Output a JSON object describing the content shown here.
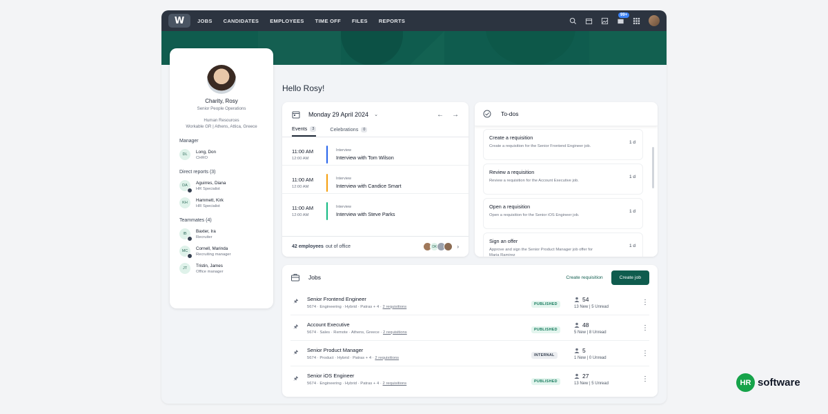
{
  "topbar": {
    "logo": "W",
    "nav": [
      "JOBS",
      "CANDIDATES",
      "EMPLOYEES",
      "TIME OFF",
      "FILES",
      "REPORTS"
    ],
    "notification_badge": "99+"
  },
  "greeting": "Hello Rosy!",
  "profile": {
    "name": "Charity, Rosy",
    "title": "Senior People Operations",
    "department": "Human Resources",
    "location": "Workable GR | Athens, Attica, Greece",
    "manager_title": "Manager",
    "manager": {
      "initials": "DL",
      "name": "Long, Don",
      "role": "CHRO"
    },
    "reports_title": "Direct reports  (3)",
    "reports": [
      {
        "initials": "DA",
        "name": "Aguirres, Diana",
        "role": "HR Specialist"
      },
      {
        "initials": "KH",
        "name": "Hammett, Kirk",
        "role": "HR Specialist"
      }
    ],
    "teammates_title": "Teammates (4)",
    "teammates": [
      {
        "initials": "IB",
        "name": "Baxter, Ira",
        "role": "Recruiter"
      },
      {
        "initials": "MC",
        "name": "Cornell, Marinda",
        "role": "Recruiting manager"
      },
      {
        "initials": "JT",
        "name": "Tristin, James",
        "role": "Office manager"
      }
    ]
  },
  "calendar": {
    "date": "Monday 29 April 2024",
    "tabs": [
      {
        "label": "Events",
        "count": "3"
      },
      {
        "label": "Celebrations",
        "count": "0"
      }
    ],
    "events": [
      {
        "start": "11:00 AM",
        "end": "12:00 AM",
        "type": "Interview",
        "title": "Interview with Tom Wilson",
        "color": "#2563eb"
      },
      {
        "start": "11:00 AM",
        "end": "12:00 AM",
        "type": "Interview",
        "title": "Interview with Candice Smart",
        "color": "#f59e0b"
      },
      {
        "start": "11:00 AM",
        "end": "12:00 AM",
        "type": "Interview",
        "title": "Interview with Steve Parks",
        "color": "#10b981"
      }
    ],
    "footer_count": "42 employees",
    "footer_text": "out of office",
    "footer_avatar_initials": "DK"
  },
  "todos": {
    "title": "To-dos",
    "items": [
      {
        "title": "Create a requisition",
        "desc": "Create a requisition for the Senior Frontend Engineer  job.",
        "age": "1 d"
      },
      {
        "title": "Review a requisition",
        "desc": "Review a requisition for the Account Executive job.",
        "age": "1 d"
      },
      {
        "title": "Open a requisition",
        "desc": "Open a requisition for the Senior iOS Engineer job.",
        "age": "1 d"
      },
      {
        "title": "Sign an offer",
        "desc": "Approve and sign the Senior Product Manager job offer for Maria Ramirez",
        "age": "1 d"
      }
    ]
  },
  "jobs": {
    "title": "Jobs",
    "create_requisition": "Create requisition",
    "create_job": "Create job",
    "rows": [
      {
        "name": "Senior Frontend Engineer",
        "meta": "5674 · Engineering · Hybrid · Patras + 4 · ",
        "req": "2 requisitions",
        "status": "PUBLISHED",
        "total": "54",
        "new": "13 New",
        "unread": "5 Unread"
      },
      {
        "name": "Account Executive",
        "meta": "5674 · Sales · Remote · Athens, Greece · ",
        "req": "2 requisitions",
        "status": "PUBLISHED",
        "total": "48",
        "new": "5 New",
        "unread": "8 Unread"
      },
      {
        "name": "Senior Product Manager",
        "meta": "5674 · Product · Hybrid · Patras + 4 · ",
        "req": "2 requisitions",
        "status": "INTERNAL",
        "total": "5",
        "new": "1 New",
        "unread": "0 Unread"
      },
      {
        "name": "Senior iOS Engineer",
        "meta": "5674 · Engineering · Hybrid · Patras + 4 · ",
        "req": "2 requisitions",
        "status": "PUBLISHED",
        "total": "27",
        "new": "13 New",
        "unread": "5 Unread"
      }
    ]
  },
  "watermark": {
    "mark": "HR",
    "text": "software"
  }
}
